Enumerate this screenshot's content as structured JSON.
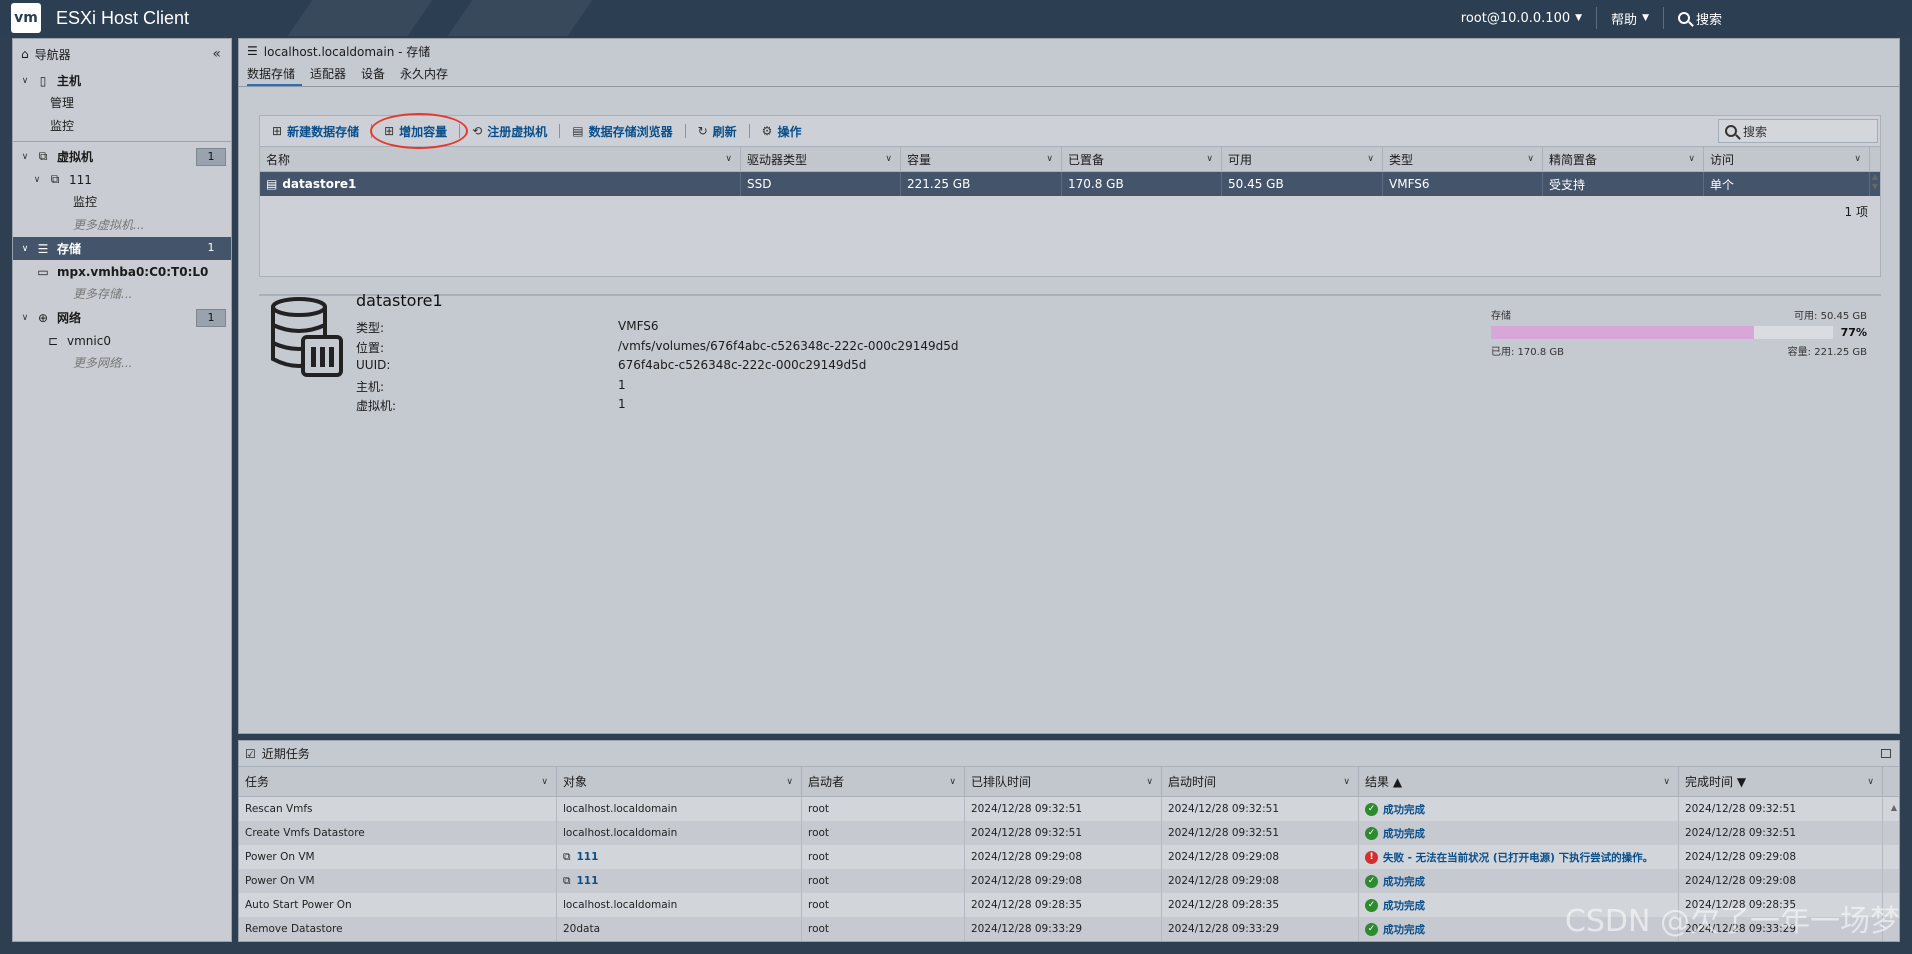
{
  "header": {
    "logo": "vm",
    "title": "ESXi Host Client",
    "user": "root@10.0.0.100",
    "help": "帮助",
    "search": "搜索"
  },
  "navigator": {
    "title": "导航器",
    "host": {
      "label": "主机",
      "children": [
        "管理",
        "监控"
      ]
    },
    "vms": {
      "label": "虚拟机",
      "count": "1",
      "vm_name": "111",
      "vm_child": "监控",
      "more": "更多虚拟机..."
    },
    "storage": {
      "label": "存储",
      "count": "1",
      "item": "mpx.vmhba0:C0:T0:L0",
      "more": "更多存储..."
    },
    "network": {
      "label": "网络",
      "count": "1",
      "item": "vmnic0",
      "more": "更多网络..."
    }
  },
  "main": {
    "title": "localhost.localdomain - 存储",
    "tabs": [
      "数据存储",
      "适配器",
      "设备",
      "永久内存"
    ],
    "active_tab": "数据存储",
    "toolbar": {
      "new_datastore": "新建数据存储",
      "increase_capacity": "增加容量",
      "register_vm": "注册虚拟机",
      "browser": "数据存储浏览器",
      "refresh": "刷新",
      "actions": "操作",
      "search_placeholder": "搜索"
    },
    "columns": [
      "名称",
      "驱动器类型",
      "容量",
      "已置备",
      "可用",
      "类型",
      "精简置备",
      "访问"
    ],
    "rows": [
      [
        "datastore1",
        "SSD",
        "221.25 GB",
        "170.8 GB",
        "50.45 GB",
        "VMFS6",
        "受支持",
        "单个"
      ]
    ],
    "footer": "1 项"
  },
  "detail": {
    "name": "datastore1",
    "props": [
      {
        "k": "类型:",
        "v": "VMFS6"
      },
      {
        "k": "位置:",
        "v": "/vmfs/volumes/676f4abc-c526348c-222c-000c29149d5d"
      },
      {
        "k": "UUID:",
        "v": "676f4abc-c526348c-222c-000c29149d5d"
      },
      {
        "k": "主机:",
        "v": "1"
      },
      {
        "k": "虚拟机:",
        "v": "1"
      }
    ],
    "capacity": {
      "label": "存储",
      "free": "可用: 50.45 GB",
      "used": "已用: 170.8 GB",
      "total": "容量: 221.25 GB",
      "percent_text": "77%",
      "fraction": 0.77,
      "fill_color": "#d9a6da"
    }
  },
  "tasks": {
    "title": "近期任务",
    "columns": [
      "任务",
      "对象",
      "启动者",
      "已排队时间",
      "启动时间",
      "结果 ▲",
      "完成时间 ▼"
    ],
    "rows": [
      {
        "task": "Rescan Vmfs",
        "object": "localhost.localdomain",
        "obj_vm": false,
        "initiator": "root",
        "queued": "2024/12/28 09:32:51",
        "started": "2024/12/28 09:32:51",
        "result": "成功完成",
        "ok": true,
        "completed": "2024/12/28 09:32:51"
      },
      {
        "task": "Create Vmfs Datastore",
        "object": "localhost.localdomain",
        "obj_vm": false,
        "initiator": "root",
        "queued": "2024/12/28 09:32:51",
        "started": "2024/12/28 09:32:51",
        "result": "成功完成",
        "ok": true,
        "completed": "2024/12/28 09:32:51"
      },
      {
        "task": "Power On VM",
        "object": "111",
        "obj_vm": true,
        "initiator": "root",
        "queued": "2024/12/28 09:29:08",
        "started": "2024/12/28 09:29:08",
        "result": "失败 - 无法在当前状况 (已打开电源) 下执行尝试的操作。",
        "ok": false,
        "completed": "2024/12/28 09:29:08"
      },
      {
        "task": "Power On VM",
        "object": "111",
        "obj_vm": true,
        "initiator": "root",
        "queued": "2024/12/28 09:29:08",
        "started": "2024/12/28 09:29:08",
        "result": "成功完成",
        "ok": true,
        "completed": "2024/12/28 09:29:08"
      },
      {
        "task": "Auto Start Power On",
        "object": "localhost.localdomain",
        "obj_vm": false,
        "initiator": "root",
        "queued": "2024/12/28 09:28:35",
        "started": "2024/12/28 09:28:35",
        "result": "成功完成",
        "ok": true,
        "completed": "2024/12/28 09:28:35"
      },
      {
        "task": "Remove Datastore",
        "object": "20data",
        "obj_vm": false,
        "initiator": "root",
        "queued": "2024/12/28 09:33:29",
        "started": "2024/12/28 09:33:29",
        "result": "成功完成",
        "ok": true,
        "completed": "2024/12/28 09:33:29"
      }
    ]
  },
  "watermark": "CSDN @欠了一年一场梦"
}
